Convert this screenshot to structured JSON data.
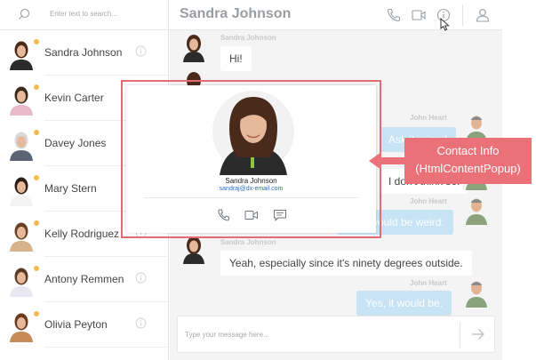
{
  "search": {
    "placeholder": "Enter text to search...",
    "icon": "search-icon"
  },
  "contacts": [
    {
      "name": "Sandra Johnson",
      "online": true,
      "shirt": "#2b2b2b",
      "hair": "#4a2a1a"
    },
    {
      "name": "Kevin Carter",
      "online": true,
      "shirt": "#e7b9c9",
      "hair": "#3a2a1a"
    },
    {
      "name": "Davey Jones",
      "online": true,
      "shirt": "#5a6475",
      "hair": "#d9d9d9"
    },
    {
      "name": "Mary Stern",
      "online": true,
      "shirt": "#f3f3f3",
      "hair": "#2d1e16"
    },
    {
      "name": "Kelly Rodriguez",
      "online": true,
      "shirt": "#d8b48c",
      "hair": "#6b4026"
    },
    {
      "name": "Antony Remmen",
      "online": true,
      "shirt": "#e8e8f4",
      "hair": "#5a3a22"
    },
    {
      "name": "Olivia Peyton",
      "online": true,
      "shirt": "#c78b5a",
      "hair": "#6b3b1e"
    }
  ],
  "header": {
    "title": "Sandra Johnson",
    "icons": [
      "phone-icon",
      "video-icon",
      "info-icon",
      "user-icon"
    ]
  },
  "messages": [
    {
      "author": "Sandra Johnson",
      "text": "Hi!",
      "direction": "in"
    },
    {
      "author": "John Heart",
      "text": "Ask it rained",
      "direction": "out"
    },
    {
      "author": "John Heart",
      "text": "I don't think so.",
      "direction": "out"
    },
    {
      "author": "John Heart",
      "text": "That would be weird.",
      "direction": "out"
    },
    {
      "author": "Sandra Johnson",
      "text": "Yeah, especially since it's ninety degrees outside.",
      "direction": "in"
    },
    {
      "author": "John Heart",
      "text": "Yes, it would be.",
      "direction": "out"
    }
  ],
  "composer": {
    "placeholder": "Type your message here...",
    "send_icon": "send-icon"
  },
  "popup": {
    "name": "Sandra Johnson",
    "email": "sandraj@dx-email.com",
    "actions": [
      "phone-icon",
      "video-icon",
      "message-icon"
    ]
  },
  "callout": {
    "line1": "Contact Info",
    "line2": "(HtmlContentPopup)"
  },
  "colors": {
    "accent_red": "#ea7178",
    "popup_border": "#e36c74",
    "online_dot": "#f5b94d",
    "outgoing_bubble": "#c7e3f4",
    "email_link": "#2a6fc9",
    "header_title": "#9a9ea3"
  }
}
